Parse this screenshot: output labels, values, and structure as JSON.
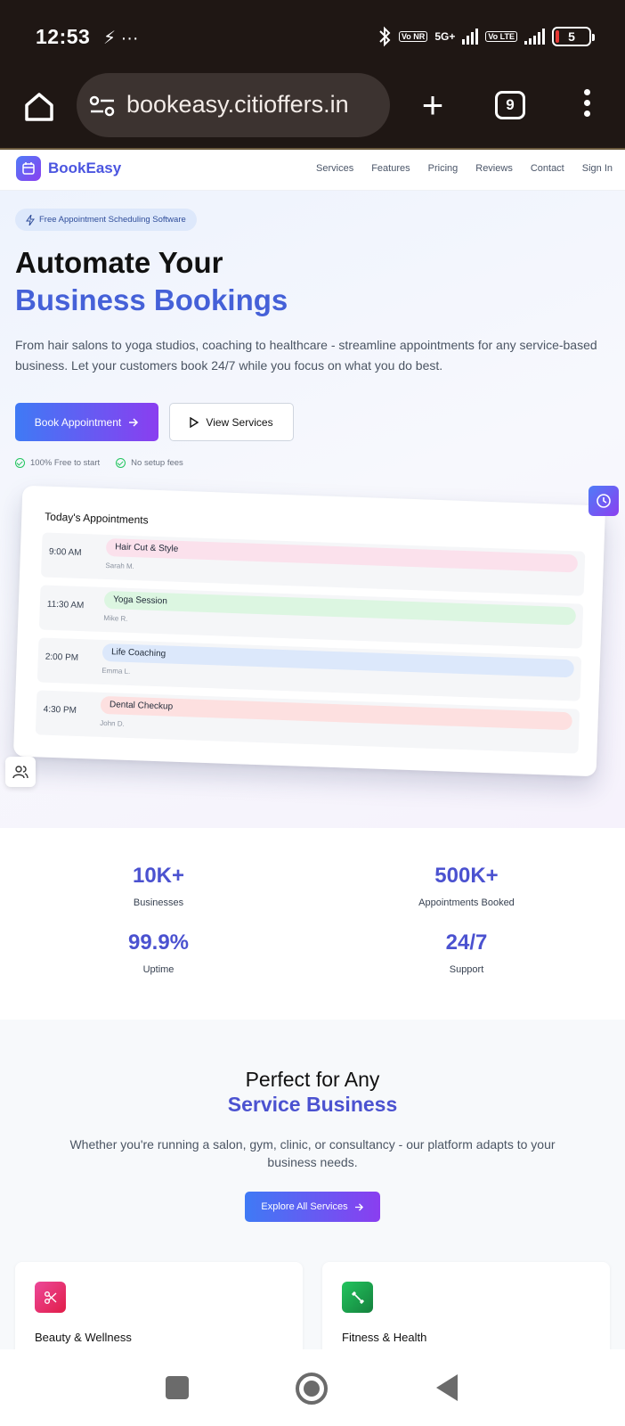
{
  "status_bar": {
    "time": "12:53",
    "notif": "⚡ ···",
    "net": "5G+",
    "chip1": "Vo NR",
    "chip2": "Vo LTE",
    "battery": "5"
  },
  "browser": {
    "url": "bookeasy.citioffers.in",
    "tab_count": "9"
  },
  "nav": {
    "brand": "BookEasy",
    "links": [
      "Services",
      "Features",
      "Pricing",
      "Reviews",
      "Contact",
      "Sign In"
    ]
  },
  "hero": {
    "badge": "Free Appointment Scheduling Software",
    "title_line1": "Automate Your",
    "title_line2": "Business Bookings",
    "lead": "From hair salons to yoga studios, coaching to healthcare - streamline appointments for any service-based business. Let your customers book 24/7 while you focus on what you do best.",
    "primary_button": "Book Appointment",
    "secondary_button": "View Services",
    "checks": [
      "100% Free to start",
      "No setup fees"
    ]
  },
  "appointments_card": {
    "title": "Today's Appointments",
    "items": [
      {
        "time": "9:00 AM",
        "service": "Hair Cut & Style",
        "client": "Sarah M.",
        "color": "#fbe1ec"
      },
      {
        "time": "11:30 AM",
        "service": "Yoga Session",
        "client": "Mike R.",
        "color": "#dcf6e1"
      },
      {
        "time": "2:00 PM",
        "service": "Life Coaching",
        "client": "Emma L.",
        "color": "#dce8fb"
      },
      {
        "time": "4:30 PM",
        "service": "Dental Checkup",
        "client": "John D.",
        "color": "#fde0e0"
      }
    ]
  },
  "stats": [
    {
      "value": "10K+",
      "label": "Businesses"
    },
    {
      "value": "500K+",
      "label": "Appointments Booked"
    },
    {
      "value": "99.9%",
      "label": "Uptime"
    },
    {
      "value": "24/7",
      "label": "Support"
    }
  ],
  "services_section": {
    "title_line1": "Perfect for Any",
    "title_line2": "Service Business",
    "description": "Whether you're running a salon, gym, clinic, or consultancy - our platform adapts to your business needs.",
    "button": "Explore All Services",
    "cards": [
      {
        "title": "Beauty & Wellness",
        "icon": "scissors-icon",
        "color": "#e91e63"
      },
      {
        "title": "Fitness & Health",
        "icon": "dumbbell-icon",
        "color": "#16a34a"
      }
    ]
  }
}
